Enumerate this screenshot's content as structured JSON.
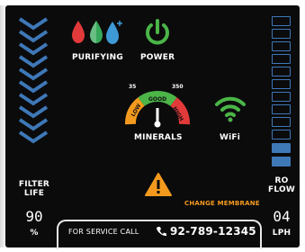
{
  "filter": {
    "label_line1": "FILTER",
    "label_line2": "LIFE",
    "value": "90",
    "unit": "%",
    "level_segments": 10
  },
  "ro_flow": {
    "label_line1": "RO",
    "label_line2": "FLOW",
    "value": "04",
    "unit": "LPH",
    "segments_total": 12,
    "segments_filled": 2
  },
  "status": {
    "purifying_label": "PURIFYING",
    "power_label": "POWER",
    "minerals_label": "MINERALS",
    "wifi_label": "WiFi"
  },
  "gauge": {
    "low_label": "LOW",
    "good_label": "GOOD",
    "high_label": "HIGH",
    "mark_left": "35",
    "mark_right": "350"
  },
  "alert": {
    "message": "CHANGE MEMBRANE"
  },
  "service": {
    "text": "FOR SERVICE CALL",
    "phone": "92-789-12345"
  },
  "colors": {
    "accent_blue": "#3e78b7",
    "power_green": "#4bb548",
    "alert_orange": "#f39a1e",
    "drop_red": "#e23a3a",
    "drop_blue": "#3e9ad6",
    "drop_green": "#36a85a"
  }
}
